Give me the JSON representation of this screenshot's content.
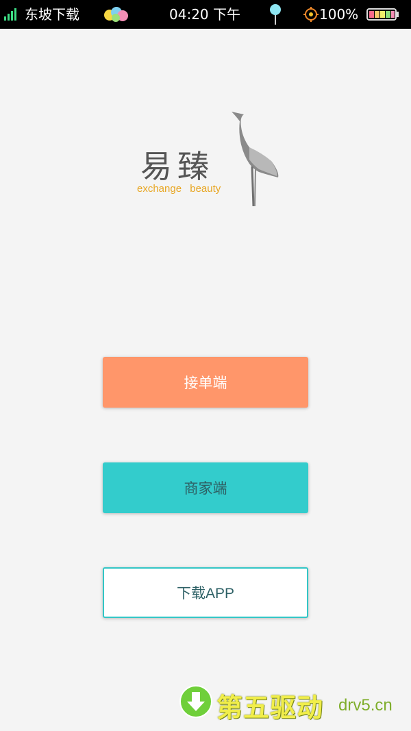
{
  "status_bar": {
    "carrier": "东坡下载",
    "time": "04:20 下午",
    "battery": "100%"
  },
  "logo": {
    "chinese": "易臻",
    "english": "exchange beauty"
  },
  "buttons": {
    "order_label": "接单端",
    "merchant_label": "商家端",
    "download_label": "下载APP"
  },
  "watermark": {
    "chinese": "第五驱动",
    "site": "drv5.cn"
  },
  "colors": {
    "order_button": "#ff966a",
    "merchant_button": "#33cccc",
    "download_border": "#33c6c6",
    "logo_accent": "#e8a622"
  }
}
